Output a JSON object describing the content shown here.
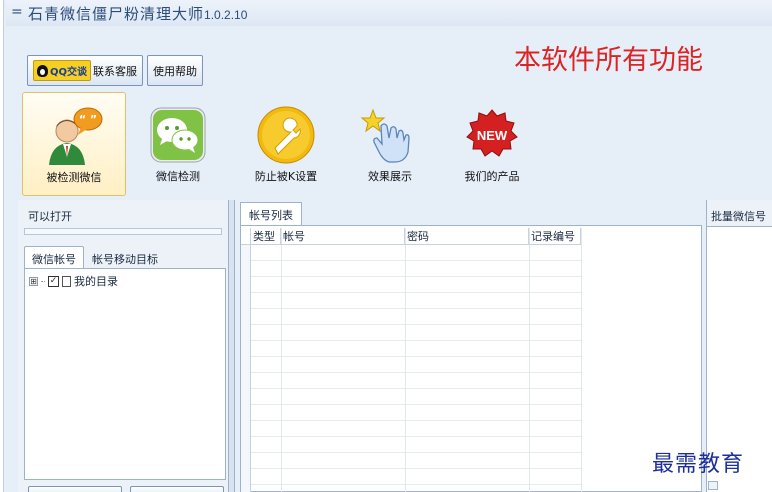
{
  "window": {
    "menu_glyph": "=",
    "title": "石青微信僵尸粉清理大师",
    "version": "1.0.2.10"
  },
  "top_buttons": {
    "qq_badge": "QQ交谈",
    "support": "联系客服",
    "help": "使用帮助"
  },
  "banner": "本软件所有功能",
  "toolbar": [
    {
      "label": "被检测微信",
      "icon": "user-chat-icon"
    },
    {
      "label": "微信检测",
      "icon": "wechat-icon"
    },
    {
      "label": "防止被K设置",
      "icon": "wrench-icon"
    },
    {
      "label": "效果展示",
      "icon": "pointer-star-icon"
    },
    {
      "label": "我们的产品",
      "icon": "new-badge-icon",
      "badge": "NEW"
    }
  ],
  "left_panel": {
    "header": "可以打开",
    "tabs": [
      "微信帐号",
      "帐号移动目标"
    ],
    "tree": [
      {
        "expander": "⊞",
        "check": "✓",
        "label": "我的目录"
      }
    ]
  },
  "center_panel": {
    "tab": "帐号列表",
    "columns": [
      "类型",
      "帐号",
      "密码",
      "记录编号"
    ]
  },
  "right_panel": {
    "header": "批量微信号"
  },
  "watermark": "最需教育",
  "colors": {
    "banner_red": "#dd2424",
    "watermark_blue": "#1d2f9a",
    "window_bg": "#e6eef8"
  }
}
